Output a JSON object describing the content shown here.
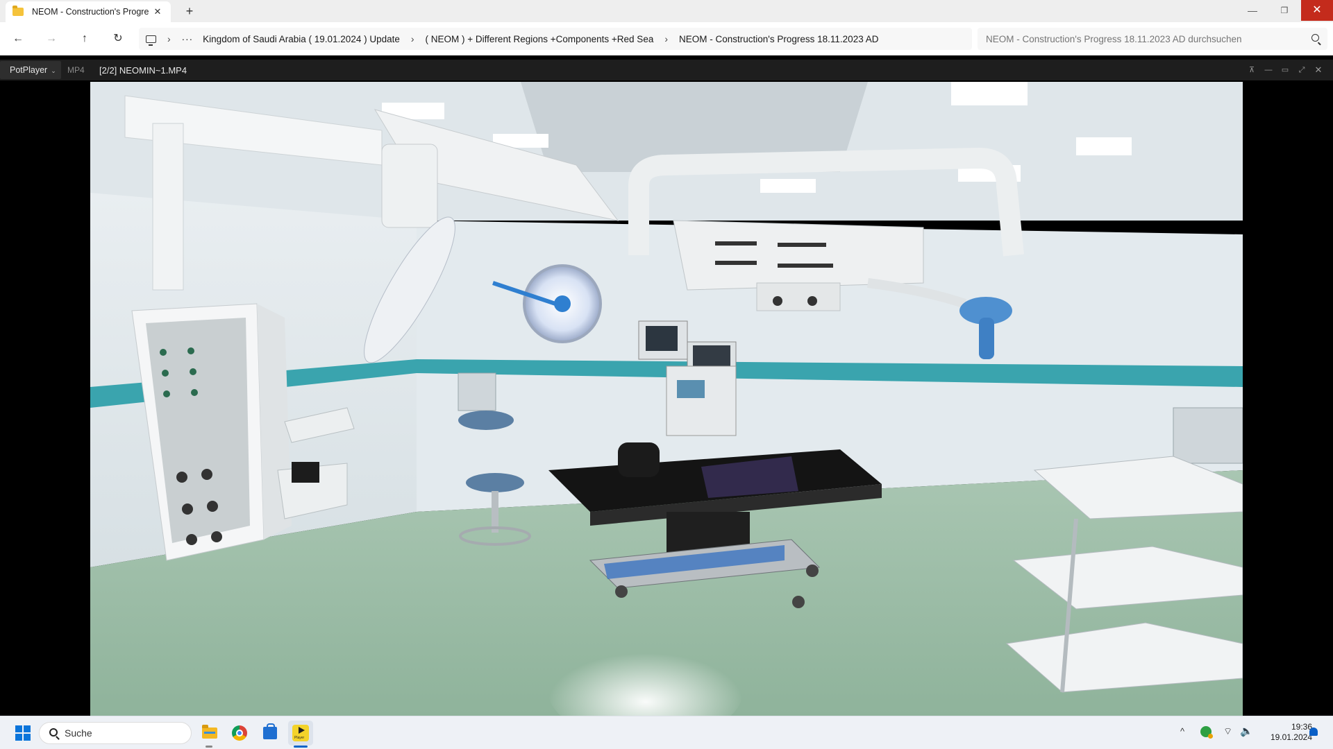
{
  "explorer": {
    "tab_title": "NEOM - Construction's Progre",
    "tab_close": "✕",
    "new_tab": "+",
    "window_controls": {
      "minimize": "—",
      "restore": "❐",
      "close": "✕"
    },
    "nav": {
      "back": "←",
      "forward": "→",
      "up": "↑",
      "refresh": "↻"
    },
    "breadcrumb": {
      "more": "···",
      "separator": "›",
      "items": [
        "Kingdom of Saudi Arabia ( 19.01.2024 ) Update",
        "( NEOM ) + Different Regions +Components +Red Sea",
        "NEOM - Construction's Progress 18.11.2023 AD"
      ]
    },
    "search": {
      "placeholder": "NEOM - Construction's Progress 18.11.2023 AD durchsuchen"
    }
  },
  "player": {
    "app_name": "PotPlayer",
    "menu_chevron": "⌄",
    "format": "MP4",
    "title": "[2/2] NEOMIN~1.MP4",
    "controls": {
      "pin": "⊼",
      "minimize": "—",
      "maximize": "▭",
      "fullscreen": "⤢",
      "close": "✕"
    }
  },
  "taskbar": {
    "search_placeholder": "Suche",
    "tray": {
      "chevron": "^",
      "wifi": "⌔",
      "volume": "🔈"
    },
    "time": "19:36",
    "date": "19.01.2024",
    "active_app_label": "Player"
  }
}
